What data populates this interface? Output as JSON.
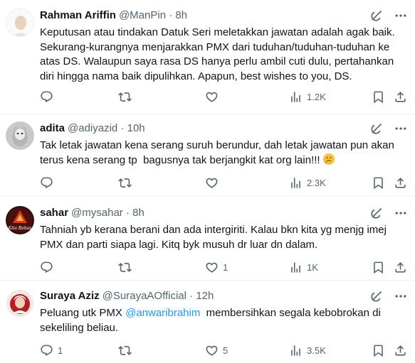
{
  "tweets": [
    {
      "name": "Rahman Ariffin",
      "handle": "@ManPin",
      "dot": "·",
      "time": "8h",
      "text": "Keputusan atau tindakan Datuk Seri meletakkan jawatan adalah agak baik. Sekurang-kurangnya menjarakkan PMX dari tuduhan/tuduhan-tuduhan ke atas DS. Walaupun saya rasa DS hanya perlu ambil cuti dulu, pertahankan diri hingga nama baik dipulihkan. Apapun, best wishes to you, DS.",
      "replies": "",
      "retweets": "",
      "likes": "",
      "views": "1.2K"
    },
    {
      "name": "adita",
      "handle": "@adiyazid",
      "dot": "·",
      "time": "10h",
      "text": "Tak letak jawatan kena serang suruh berundur, dah letak jawatan pun akan terus kena serang tp  bagusnya tak berjangkit kat org lain!!! ",
      "emoji": "thinking-face",
      "replies": "",
      "retweets": "",
      "likes": "",
      "views": "2.3K"
    },
    {
      "name": "sahar",
      "handle": "@mysahar",
      "dot": "·",
      "time": "8h",
      "text": "Tahniah yb kerana berani dan ada intergiriti. Kalau bkn kita yg menjg imej PMX dan parti siapa lagi. Kitq byk musuh dr luar dn dalam.",
      "replies": "",
      "retweets": "",
      "likes": "1",
      "views": "1K"
    },
    {
      "name": "Suraya Aziz",
      "handle": "@SurayaAOfficial",
      "dot": "·",
      "time": "12h",
      "text_before": "Peluang utk PMX ",
      "mention": "@anwaribrahim",
      "text_after": "  membersihkan segala kebobrokan di sekeliling beliau.",
      "replies": "1",
      "retweets": "",
      "likes": "5",
      "views": "3.5K"
    }
  ],
  "colors": {
    "text": "#0f1419",
    "secondary": "#536471",
    "link": "#1d9bf0",
    "divider": "#eff3f4"
  },
  "icons": [
    "reply-icon",
    "retweet-icon",
    "like-icon",
    "views-icon",
    "bookmark-icon",
    "share-icon",
    "grok-icon",
    "more-icon"
  ]
}
